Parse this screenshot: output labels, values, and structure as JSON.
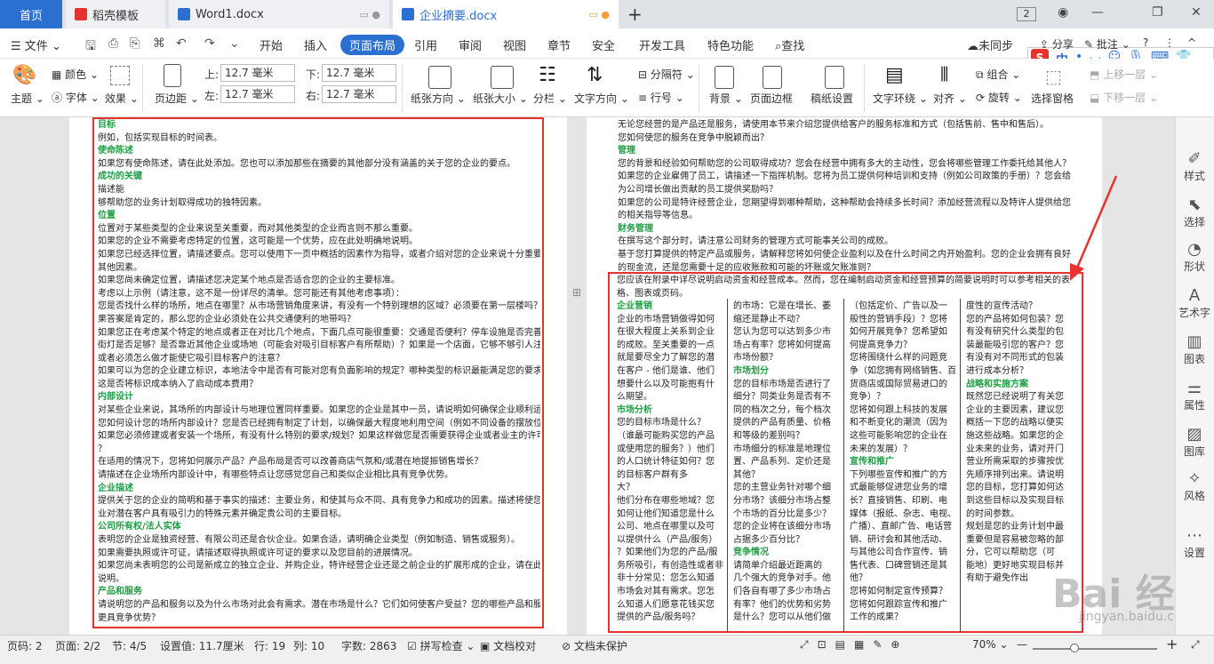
{
  "tabs": {
    "home": "首页",
    "t1": "稻壳模板",
    "t2": "Word1.docx",
    "t3": "企业摘要.docx",
    "count": "2"
  },
  "menu": {
    "file": "文件",
    "items": [
      "开始",
      "插入",
      "页面布局",
      "引用",
      "审阅",
      "视图",
      "章节",
      "安全",
      "开发工具",
      "特色功能"
    ],
    "search": "查找",
    "sync": "未同步",
    "share": "分享",
    "annotate": "批注"
  },
  "ribbon": {
    "theme": "主题",
    "color": "颜色",
    "font": "字体",
    "effect": "效果",
    "margins": "页边距",
    "top_label": "上:",
    "top_value": "12.7 毫米",
    "bottom_label": "下:",
    "bottom_value": "12.7 毫米",
    "left_label": "左:",
    "left_value": "12.7 毫米",
    "right_label": "右:",
    "right_value": "12.7 毫米",
    "orientation": "纸张方向",
    "size": "纸张大小",
    "columns": "分栏",
    "text_dir": "文字方向",
    "separator": "分隔符",
    "line_num": "行号",
    "background": "背景",
    "border": "页面边框",
    "draft": "稿纸设置",
    "wrap": "文字环绕",
    "align": "对齐",
    "group": "组合",
    "rotate": "旋转",
    "selpane": "选择窗格",
    "up": "上移一层",
    "down": "下移一层"
  },
  "sogou": {
    "ime": "中"
  },
  "left_page": [
    {
      "t": "目标",
      "h": true
    },
    {
      "t": "例如，包括实现目标的时间表。"
    },
    {
      "t": "使命陈述",
      "h": true
    },
    {
      "t": "如果您有使命陈述，请在此处添加。您也可以添加那些在摘要的其他部分没有涵盖的关于您的企业的要点。"
    },
    {
      "t": "成功的关键",
      "h": true
    },
    {
      "t": "描述能"
    },
    {
      "t": "够帮助您的业务计划取得成功的独特因素。"
    },
    {
      "t": "位置",
      "h": true
    },
    {
      "t": "位置对于某些类型的企业来说至关重要，而对其他类型的企业而言则不那么重要。"
    },
    {
      "t": "如果您的企业不需要考虑特定的位置，这可能是一个优势，应在此处明确地说明。"
    },
    {
      "t": "如果您已经选择位置，请描述要点。您可以使用下一页中概括的因素作为指导，或者介绍对您的企业来说十分重要的"
    },
    {
      "t": "其他因素。"
    },
    {
      "t": "如果您尚未确定位置，请描述您决定某个地点是否适合您的企业的主要标准。"
    },
    {
      "t": "考虑以上示例（请注意，这不是一份详尽的清单。您可能还有其他考虑事项）："
    },
    {
      "t": "您是否找什么样的场所，地点在哪里？从市场营销角度来讲，有没有一个特别理想的区域？必须要在第一层楼吗？如"
    },
    {
      "t": "果答案是肯定的，那么您的企业必须处在公共交通便利的地带吗？"
    },
    {
      "t": "如果您正在考虑某个特定的地点或者正在对比几个地点，下面几点可能很重要：交通是否便利？停车设施是否完善？"
    },
    {
      "t": "街灯是否足够？是否靠近其他企业或场地（可能会对吸引目标客户有所帮助）？如果是一个店面，它够不够引人注意"
    },
    {
      "t": "或者必须怎么做才能使它吸引目标客户的注意？"
    },
    {
      "t": "如果可以为您的企业建立标识，本地法令中是否有可能对您有负面影响的规定？哪种类型的标识最能满足您的要求？"
    },
    {
      "t": "这是否将标识成本纳入了启动成本费用？"
    },
    {
      "t": "内部设计",
      "h": true
    },
    {
      "t": "对某些企业来说，其场所的内部设计与地理位置同样重要。如果您的企业是其中一员，请说明如何确保企业顺利运转"
    },
    {
      "t": "您如何设计您的场所内部设计？您是否已经拥有制定了计划，以确保最大程度地利用空间（例如不同设备的摆放位置）"
    },
    {
      "t": "如果您必须修建或者安装一个场所，有没有什么特别的要求/规划？如果这样做您是否需要获得企业或者业主的许可"
    },
    {
      "t": "？"
    },
    {
      "t": "在适用的情况下，您将如何展示产品？产品布局是否可以改善商店气氛和/或潜在地提振销售增长？"
    },
    {
      "t": "请描述在企业场所内部设计中，有哪些特点让您感觉您自己和类似企业相比具有竞争优势。"
    },
    {
      "t": "企业描述",
      "h": true
    },
    {
      "t": "提供关于您的企业的简明和基于事实的描述：主要业务，和使其与众不同、具有竞争力和成功的因素。描述将使您的企"
    },
    {
      "t": "业对潜在客户具有吸引力的特殊元素并确定贵公司的主要目标。"
    },
    {
      "t": "公司所有权/法人实体",
      "h": true
    },
    {
      "t": "表明您的企业是独资经营、有限公司还是合伙企业。如果合适，请明确企业类型（例如制造、销售或服务）。"
    },
    {
      "t": "如果需要执照或许可证，请描述取得执照或许可证的要求以及您目前的进展情况。"
    },
    {
      "t": "如果您尚未表明您的公司是新成立的独立企业、并购企业，特许经营企业还是之前企业的扩展形成的企业，请在此处添加"
    },
    {
      "t": "说明。"
    },
    {
      "t": "产品和服务",
      "h": true
    },
    {
      "t": "请说明您的产品和服务以及为什么市场对此会有需求。潜在市场是什么？它们如何使客户受益？您的哪些产品和服务"
    },
    {
      "t": "更具竞争优势？"
    }
  ],
  "right_top": [
    {
      "t": "无论您经营的是产品还是服务，请使用本节来介绍您提供给客户的服务标准和方式（包括售前、售中和售后）。"
    },
    {
      "t": "您如何使您的服务在竞争中脱颖而出？"
    },
    {
      "t": "管理",
      "h": true
    },
    {
      "t": "您的背景和经验如何帮助您的公司取得成功？您会在经营中拥有多大的主动性，您会将哪些管理工作委托给其他人？"
    },
    {
      "t": "如果您的企业雇佣了员工，请描述一下指挥机制。您将为员工提供何种培训和支持（例如公司政策的手册）？您会给"
    },
    {
      "t": "为公司增长做出贡献的员工提供奖励吗？"
    },
    {
      "t": "如果您的公司是特许经营企业，您期望得到哪种帮助，这种帮助会持续多长时间？添加经营流程以及特许人提供给您"
    },
    {
      "t": "的相关指导等信息。"
    },
    {
      "t": "财务管理",
      "h": true
    },
    {
      "t": "在撰写这个部分时，请注意公司财务的管理方式可能事关公司的成败。"
    },
    {
      "t": "基于您打算提供的特定产品或服务，请解释您将如何使企业盈利以及在什么时间之内开始盈利。您的企业会拥有良好"
    },
    {
      "t": "的现金流，还是您需要十足的应收账款和可能的坏账或欠账准则？"
    }
  ],
  "right_intro": "您应该在附录中详尽说明启动资金和经营成本。然而，您在编制启动资金和经营预算的简要说明时可以参考相关的表格、图表或页码。",
  "col1": [
    {
      "t": "企业营销",
      "h": true
    },
    {
      "t": "企业的市场营销做得如何"
    },
    {
      "t": "在很大程度上关系到企业"
    },
    {
      "t": "的成败。至关重要的一点"
    },
    {
      "t": "就是要尽全力了解您的潜"
    },
    {
      "t": "在客户 - 他们是谁、他们"
    },
    {
      "t": "想要什么以及可能抱有什"
    },
    {
      "t": "么期望。"
    },
    {
      "t": "市场分析",
      "h": true
    },
    {
      "t": "您的目标市场是什么？"
    },
    {
      "t": "（谁最可能购买您的产品"
    },
    {
      "t": "或使用您的服务？）他们"
    },
    {
      "t": "的人口统计特征如何？您"
    },
    {
      "t": "的目标客户群有多"
    },
    {
      "t": "大？"
    },
    {
      "t": "他们分布在哪些地域？您"
    },
    {
      "t": "如何让他们知道您是什么"
    },
    {
      "t": "公司、地点在哪里以及可"
    },
    {
      "t": "以提供什么（产品/服务）"
    },
    {
      "t": "？如果他们为您的产品/服"
    },
    {
      "t": "务所吸引，有创造性或者非"
    },
    {
      "t": "非十分常见：您怎么知道"
    },
    {
      "t": "市场会对其有需求。您怎"
    },
    {
      "t": "么知道人们愿意花钱买您"
    },
    {
      "t": "提供的产品/服务吗？"
    }
  ],
  "col2": [
    {
      "t": "的市场：它是在增长、萎"
    },
    {
      "t": "缩还是静止不动？"
    },
    {
      "t": "您认为您可以达到多少市"
    },
    {
      "t": "场占有率？您将如何提高"
    },
    {
      "t": "市场份额？"
    },
    {
      "t": "市场划分",
      "h": true
    },
    {
      "t": "您的目标市场是否进行了"
    },
    {
      "t": "细分？同类业务是否有不"
    },
    {
      "t": "同的档次之分，每个档次"
    },
    {
      "t": "提供的产品有质量、价格"
    },
    {
      "t": "和等级的差别吗？"
    },
    {
      "t": "市场细分的标准是地理位"
    },
    {
      "t": "置、产品系列、定价还是"
    },
    {
      "t": "其他？"
    },
    {
      "t": "您的主营业务针对哪个细"
    },
    {
      "t": "分市场？该细分市场占整"
    },
    {
      "t": "个市场的百分比是多少？"
    },
    {
      "t": "您的企业将在该细分市场"
    },
    {
      "t": "占据多少百分比？"
    },
    {
      "t": "竞争情况",
      "h": true
    },
    {
      "t": "请简单介绍最近距离的"
    },
    {
      "t": "几个强大的竞争对手。他"
    },
    {
      "t": "们各自有哪了多少市场占"
    },
    {
      "t": "有率？他们的优势和劣势"
    },
    {
      "t": "是什么？您可以从他们做"
    }
  ],
  "col3": [
    {
      "t": "（包括定价、广告以及一"
    },
    {
      "t": "般性的营销手段）？您将"
    },
    {
      "t": "如何开展竞争？您希望如"
    },
    {
      "t": "何提高竞争力？"
    },
    {
      "t": "您将围绕什么样的问题竞"
    },
    {
      "t": "争（如您拥有网络销售、百"
    },
    {
      "t": "货商店或国际贸易进口的"
    },
    {
      "t": "竞争）？"
    },
    {
      "t": "您将如何跟上科技的发展"
    },
    {
      "t": "和不断变化的潮流（因为"
    },
    {
      "t": "这些可能影响您的企业在"
    },
    {
      "t": "未来的发展）？"
    },
    {
      "t": "宣传和推广",
      "h": true
    },
    {
      "t": "下列哪些宣传和推广的方"
    },
    {
      "t": "式最能够促进您业务的增"
    },
    {
      "t": "长？直接销售、印刷、电"
    },
    {
      "t": "媒体（报纸、杂志、电视、"
    },
    {
      "t": "广播）、直邮广告、电话营"
    },
    {
      "t": "销、研讨会和其他活动、"
    },
    {
      "t": "与其他公司合作宣传、销"
    },
    {
      "t": "售代表、口碑营销还是其"
    },
    {
      "t": "他？"
    },
    {
      "t": "您将如何制定宣传预算？"
    },
    {
      "t": "您将如何跟踪宣传和推广"
    },
    {
      "t": "工作的成果？"
    }
  ],
  "col4": [
    {
      "t": "度性的宣传活动？"
    },
    {
      "t": "您的产品将如何包装？您"
    },
    {
      "t": "有没有研究什么类型的包"
    },
    {
      "t": "装最能吸引您的客户？您"
    },
    {
      "t": "有没有对不同形式的包装"
    },
    {
      "t": "进行成本分析？"
    },
    {
      "t": "战略和实施方案",
      "h": true
    },
    {
      "t": "既然您已经说明了有关您"
    },
    {
      "t": "企业的主要因素，建议您"
    },
    {
      "t": "概括一下您的战略以便实"
    },
    {
      "t": "施这些战略。如果您的企"
    },
    {
      "t": "业未来的业务，请对开门"
    },
    {
      "t": "营业所需采取的步骤按优"
    },
    {
      "t": "先顺序排列出来。请说明"
    },
    {
      "t": "您的目标，您打算如何达"
    },
    {
      "t": "到这些目标以及实现目标"
    },
    {
      "t": "的时间参数。"
    },
    {
      "t": "规划是您的业务计划中最"
    },
    {
      "t": "重要但是容易被忽略的部"
    },
    {
      "t": "分，它可以帮助您（可"
    },
    {
      "t": "能地）更好地实现目标并"
    },
    {
      "t": "有助于避免作出"
    }
  ],
  "sidebar": [
    "样式",
    "选择",
    "形状",
    "艺术字",
    "图表",
    "属性",
    "图库",
    "风格",
    "设置"
  ],
  "status": {
    "page_count": "页码: 2",
    "page": "页面: 2/2",
    "section": "节: 4/5",
    "setting": "设置值: 11.7厘米",
    "row": "行: 19",
    "col": "列: 10",
    "words": "字数: 2863",
    "spell": "拼写检查",
    "proof": "文档校对",
    "protect": "文档未保护",
    "zoom": "70%"
  },
  "watermark": {
    "text": "Bai 经验",
    "url": "jingyan.baidu.com"
  },
  "colors": {
    "accent": "#2b6fd1",
    "heading": "#1f9e44",
    "highlight": "#e8322e"
  }
}
